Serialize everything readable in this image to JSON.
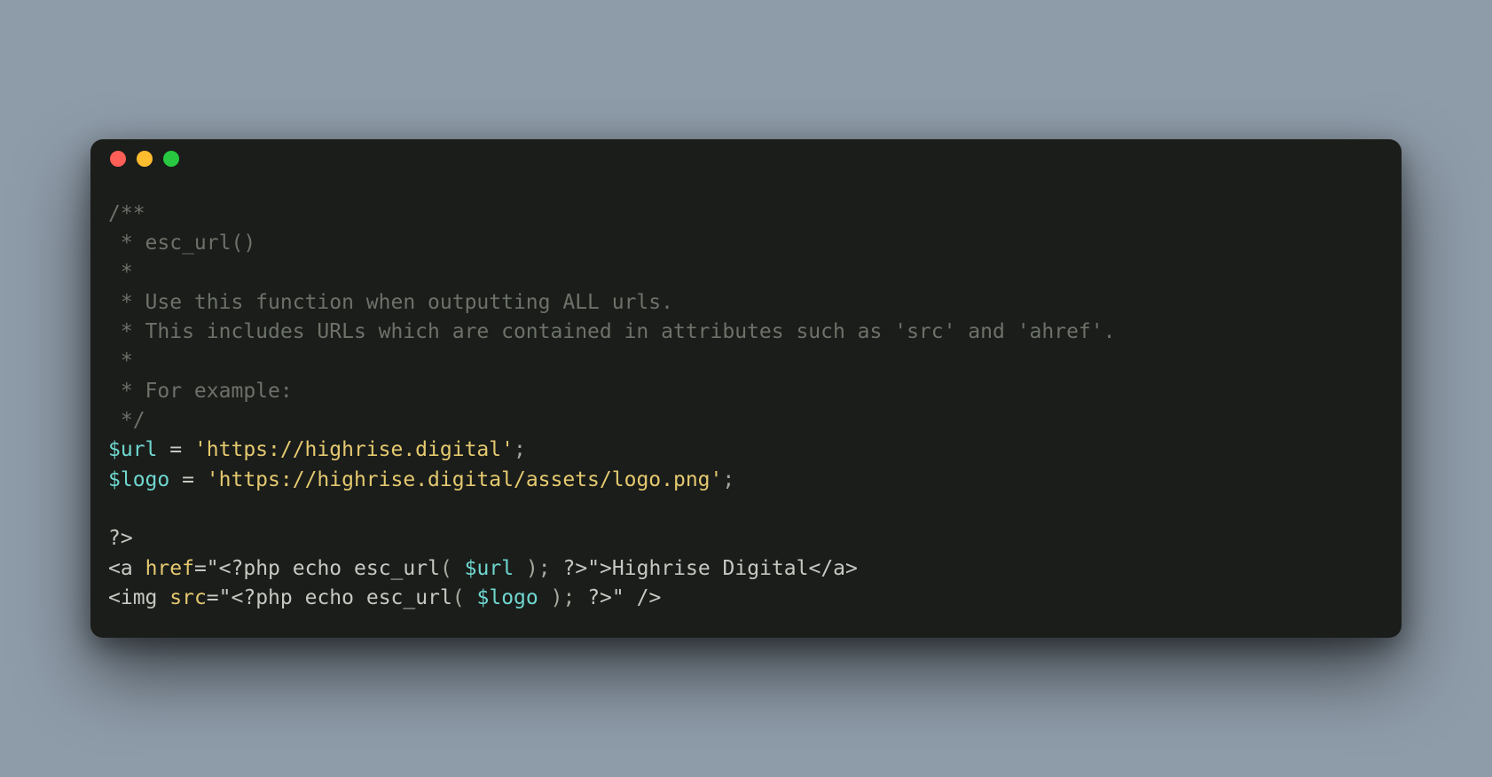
{
  "code": {
    "comment_lines": [
      "/**",
      " * esc_url()",
      " *",
      " * Use this function when outputting ALL urls.",
      " * This includes URLs which are contained in attributes such as 'src' and 'ahref'.",
      " *",
      " * For example:",
      " */"
    ],
    "var1_name": "$url",
    "var1_value": "'https://highrise.digital'",
    "var2_name": "$logo",
    "var2_value": "'https://highrise.digital/assets/logo.png'",
    "php_close": "?>",
    "a_open1": "<a",
    "a_attr_name": "href",
    "a_attr_q1": "=\"",
    "a_php_open": "<?php",
    "a_echo": "echo",
    "a_func": "esc_url",
    "a_paren_open": "(",
    "a_arg": "$url",
    "a_paren_close": ");",
    "a_php_close": "?>",
    "a_attr_q2": "\"",
    "a_gt": ">",
    "a_text": "Highrise Digital",
    "a_close": "</a>",
    "img_open": "<img",
    "img_attr_name": "src",
    "img_attr_q1": "=\"",
    "img_php_open": "<?php",
    "img_echo": "echo",
    "img_func": "esc_url",
    "img_paren_open": "(",
    "img_arg": "$logo",
    "img_paren_close": ");",
    "img_php_close": "?>",
    "img_attr_q2": "\"",
    "img_selfclose": " />",
    "eq": " = ",
    "semi": ";"
  }
}
